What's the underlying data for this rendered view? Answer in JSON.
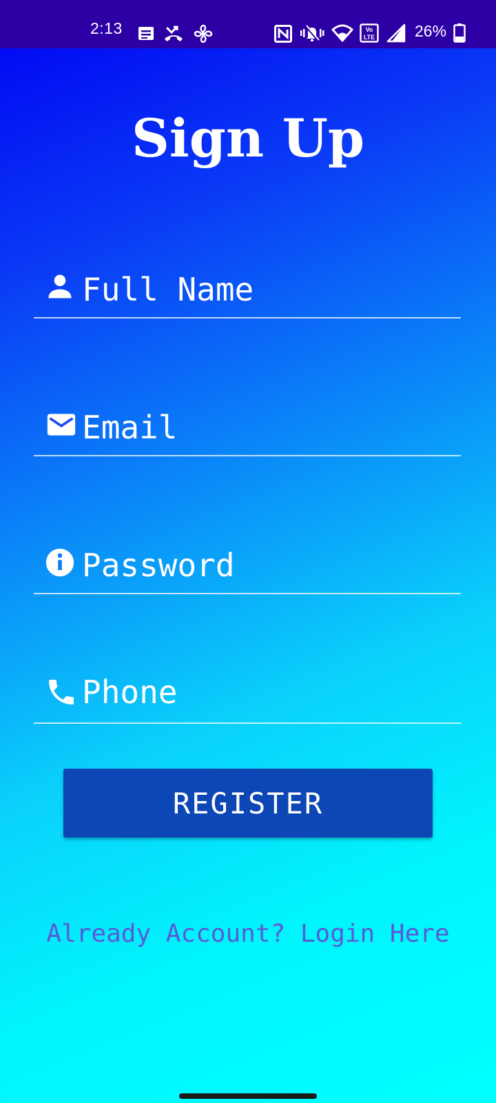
{
  "status_bar": {
    "time": "2:13",
    "battery_percent": "26%",
    "icons": [
      "notes-icon",
      "missed-call-icon",
      "fan-icon",
      "nfc-icon",
      "vibrate-icon",
      "wifi-icon",
      "volte-icon",
      "signal-icon",
      "battery-icon"
    ],
    "background_color": "#2d00a6"
  },
  "page": {
    "title": "Sign Up",
    "background_gradient": [
      "#0000f2",
      "#00ffff"
    ]
  },
  "form": {
    "fields": [
      {
        "placeholder": "Full Name",
        "value": "",
        "icon": "person-icon"
      },
      {
        "placeholder": "Email",
        "value": "",
        "icon": "mail-icon"
      },
      {
        "placeholder": "Password",
        "value": "",
        "icon": "info-icon"
      },
      {
        "placeholder": "Phone",
        "value": "",
        "icon": "phone-icon"
      }
    ],
    "register_label": "REGISTER",
    "register_color": "#0c47b5",
    "login_prompt": "Already Account? Login Here",
    "login_color": "#5a5ad6"
  }
}
